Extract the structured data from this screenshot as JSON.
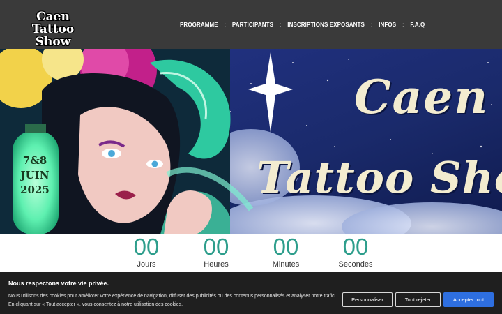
{
  "header": {
    "logo_line1": "Caen Tattoo",
    "logo_line2": "Show",
    "nav": [
      {
        "label": "PROGRAMME"
      },
      {
        "label": "PARTICIPANTS"
      },
      {
        "label": "INSCRIPTIONS EXPOSANTS"
      },
      {
        "label": "INFOS"
      },
      {
        "label": "F.A.Q"
      }
    ],
    "nav_separator": ":"
  },
  "hero": {
    "title_line1": "Caen",
    "title_line2": "Tattoo Show",
    "lantern_line1": "7&8",
    "lantern_line2": "JUIN",
    "lantern_line3": "2025",
    "colors": {
      "sky": "#1a2a6b",
      "teal": "#2ec9a0",
      "magenta": "#c2208a",
      "lantern": "#5ef0b0"
    }
  },
  "countdown": {
    "items": [
      {
        "value": "00",
        "label": "Jours"
      },
      {
        "value": "00",
        "label": "Heures"
      },
      {
        "value": "00",
        "label": "Minutes"
      },
      {
        "value": "00",
        "label": "Secondes"
      }
    ],
    "accent": "#2e9e8c"
  },
  "cookie": {
    "title": "Nous respectons votre vie privée.",
    "text_line1": "Nous utilisons des cookies pour améliorer votre expérience de navigation, diffuser des publicités ou des contenus personnalisés et analyser notre trafic.",
    "text_line2": "En cliquant sur « Tout accepter », vous consentez à notre utilisation des cookies.",
    "customize_label": "Personnaliser",
    "reject_label": "Tout rejeter",
    "accept_label": "Accepter tout",
    "accept_color": "#2e6fe0"
  }
}
